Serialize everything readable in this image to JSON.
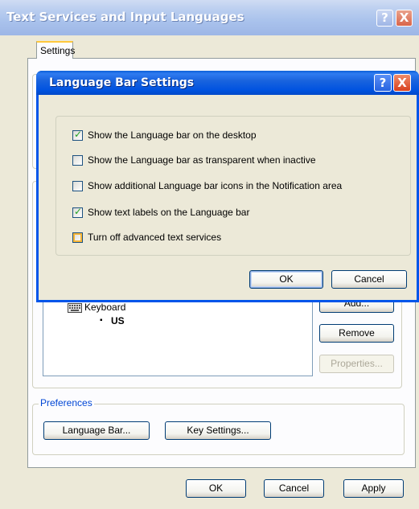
{
  "window": {
    "title": "Text Services and Input Languages",
    "help_glyph": "?",
    "close_glyph": "X",
    "tab": "Settings"
  },
  "installed_services": {
    "keyboard_label": "Keyboard",
    "layout": "US",
    "layout_bullet": "▪",
    "buttons": {
      "add": "Add...",
      "remove": "Remove",
      "properties": "Properties..."
    }
  },
  "preferences": {
    "label": "Preferences",
    "language_bar_button": "Language Bar...",
    "key_settings_button": "Key Settings..."
  },
  "footer": {
    "ok": "OK",
    "cancel": "Cancel",
    "apply": "Apply"
  },
  "dialog": {
    "title": "Language Bar Settings",
    "help_glyph": "?",
    "close_glyph": "X",
    "options": [
      {
        "label": "Show the Language bar on the desktop",
        "checked": true
      },
      {
        "label": "Show the Language bar as transparent when inactive",
        "checked": false
      },
      {
        "label": "Show additional Language bar icons in the Notification area",
        "checked": false
      },
      {
        "label": "Show text labels on the Language bar",
        "checked": true
      },
      {
        "label": "Turn off advanced text services",
        "checked": false
      }
    ],
    "ok": "OK",
    "cancel": "Cancel"
  },
  "colors": {
    "dialog_title_blue": "#0055ea",
    "group_label_blue": "#0046d5",
    "checkmark_green": "#21a121",
    "focus_orange": "#f8b636"
  }
}
